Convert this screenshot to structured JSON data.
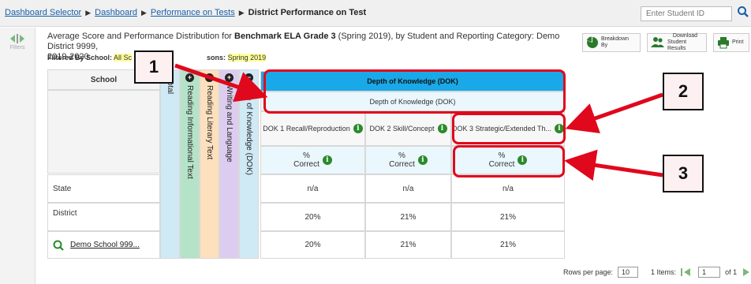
{
  "breadcrumb": {
    "items": [
      "Dashboard Selector",
      "Dashboard",
      "Performance on Tests"
    ],
    "current": "District Performance on Test"
  },
  "search": {
    "placeholder": "Enter Student ID"
  },
  "sidebar": {
    "filters_label": "Filters"
  },
  "title": {
    "prefix": "Average Score and Performance Distribution for ",
    "test_name": "Benchmark ELA Grade 3",
    "suffix": " (Spring 2019), by Student and Reporting Category: Demo District 9999,",
    "line2": "2019-2020"
  },
  "filtered_by": {
    "label_school": "Filtered By School:",
    "school_value": "All Sc",
    "label_admin": "sons:",
    "admin_value": "Spring 2019"
  },
  "toolbar": {
    "breakdown_label": "Breakdown By",
    "download_label_1": "Download",
    "download_label_2": "Student Results",
    "print_label": "Print"
  },
  "table": {
    "school_header": "School",
    "vertical_headers": [
      "otal",
      "Reading Informational Text",
      "Reading Literary Text",
      "Writing and Language",
      "epth of Knowledge (DOK)"
    ],
    "dok_group_header": "Depth of Knowledge (DOK)",
    "dok_subheader": "Depth of Knowledge (DOK)",
    "columns": [
      "DOK 1 Recall/Reproduction",
      "DOK 2 Skill/Concept",
      "DOK 3 Strategic/Extended Th..."
    ],
    "pct_line1": "%",
    "pct_line2": "Correct",
    "rows": [
      {
        "name": "State",
        "values": [
          "n/a",
          "n/a",
          "n/a"
        ]
      },
      {
        "name": "District",
        "values": [
          "20%",
          "21%",
          "21%"
        ]
      },
      {
        "name": "Demo School 999...",
        "values": [
          "20%",
          "21%",
          "21%"
        ]
      }
    ]
  },
  "callouts": [
    "1",
    "2",
    "3"
  ],
  "pagination": {
    "rows_label": "Rows per page:",
    "rows_value": "10",
    "items_label": "1 Items:",
    "page_value": "1",
    "of_label": "of 1"
  },
  "colors": {
    "accent_blue": "#1aa9e8",
    "callout_red": "#e0081c",
    "info_green": "#2a8a2a",
    "col_total": "#cfe9f5",
    "col_reading_info": "#b5e3c8",
    "col_reading_lit": "#fde0bd",
    "col_writing": "#dccdf0",
    "col_dok": "#cfe9f5"
  }
}
